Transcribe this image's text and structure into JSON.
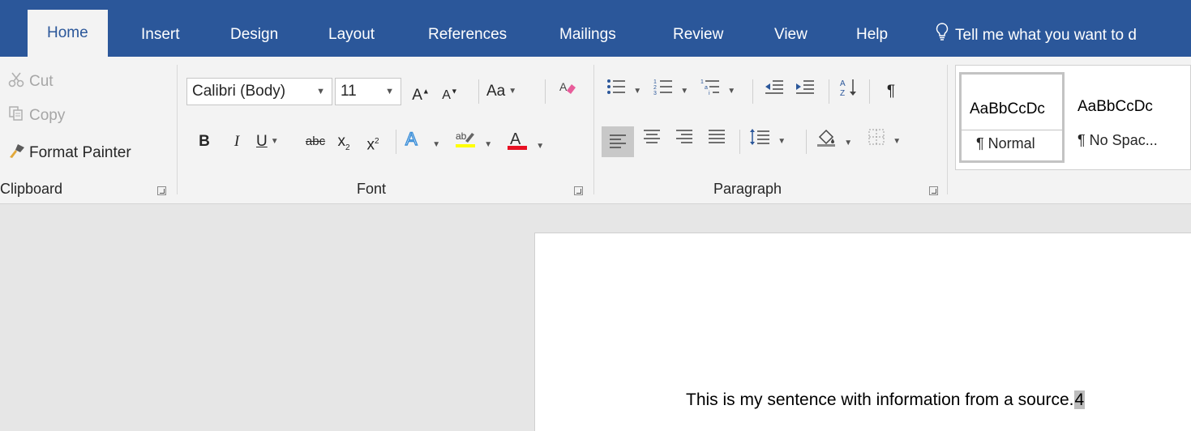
{
  "tabs": [
    {
      "label": "Home",
      "active": true
    },
    {
      "label": "Insert"
    },
    {
      "label": "Design"
    },
    {
      "label": "Layout"
    },
    {
      "label": "References"
    },
    {
      "label": "Mailings"
    },
    {
      "label": "Review"
    },
    {
      "label": "View"
    },
    {
      "label": "Help"
    }
  ],
  "tell_me": "Tell me what you want to d",
  "clipboard": {
    "cut": "Cut",
    "copy": "Copy",
    "format_painter": "Format Painter",
    "label": "Clipboard"
  },
  "font": {
    "name": "Calibri (Body)",
    "size": "11",
    "change_case": "Aa",
    "bold": "B",
    "italic": "I",
    "underline": "U",
    "strike": "abc",
    "subscript": "x",
    "superscript": "x",
    "label": "Font",
    "font_color": "#e81123",
    "highlight_color": "#ffff00"
  },
  "paragraph": {
    "label": "Paragraph"
  },
  "styles": [
    {
      "sample": "AaBbCcDc",
      "name": "¶ Normal",
      "selected": true
    },
    {
      "sample": "AaBbCcDc",
      "name": "¶ No Spac...",
      "selected": false
    }
  ],
  "document": {
    "sentence": "This is my sentence with information from a source.",
    "superscript_mark": "4"
  },
  "colors": {
    "tabbar": "#2b579a",
    "ribbon": "#f3f3f3",
    "workspace": "#e6e6e6"
  }
}
